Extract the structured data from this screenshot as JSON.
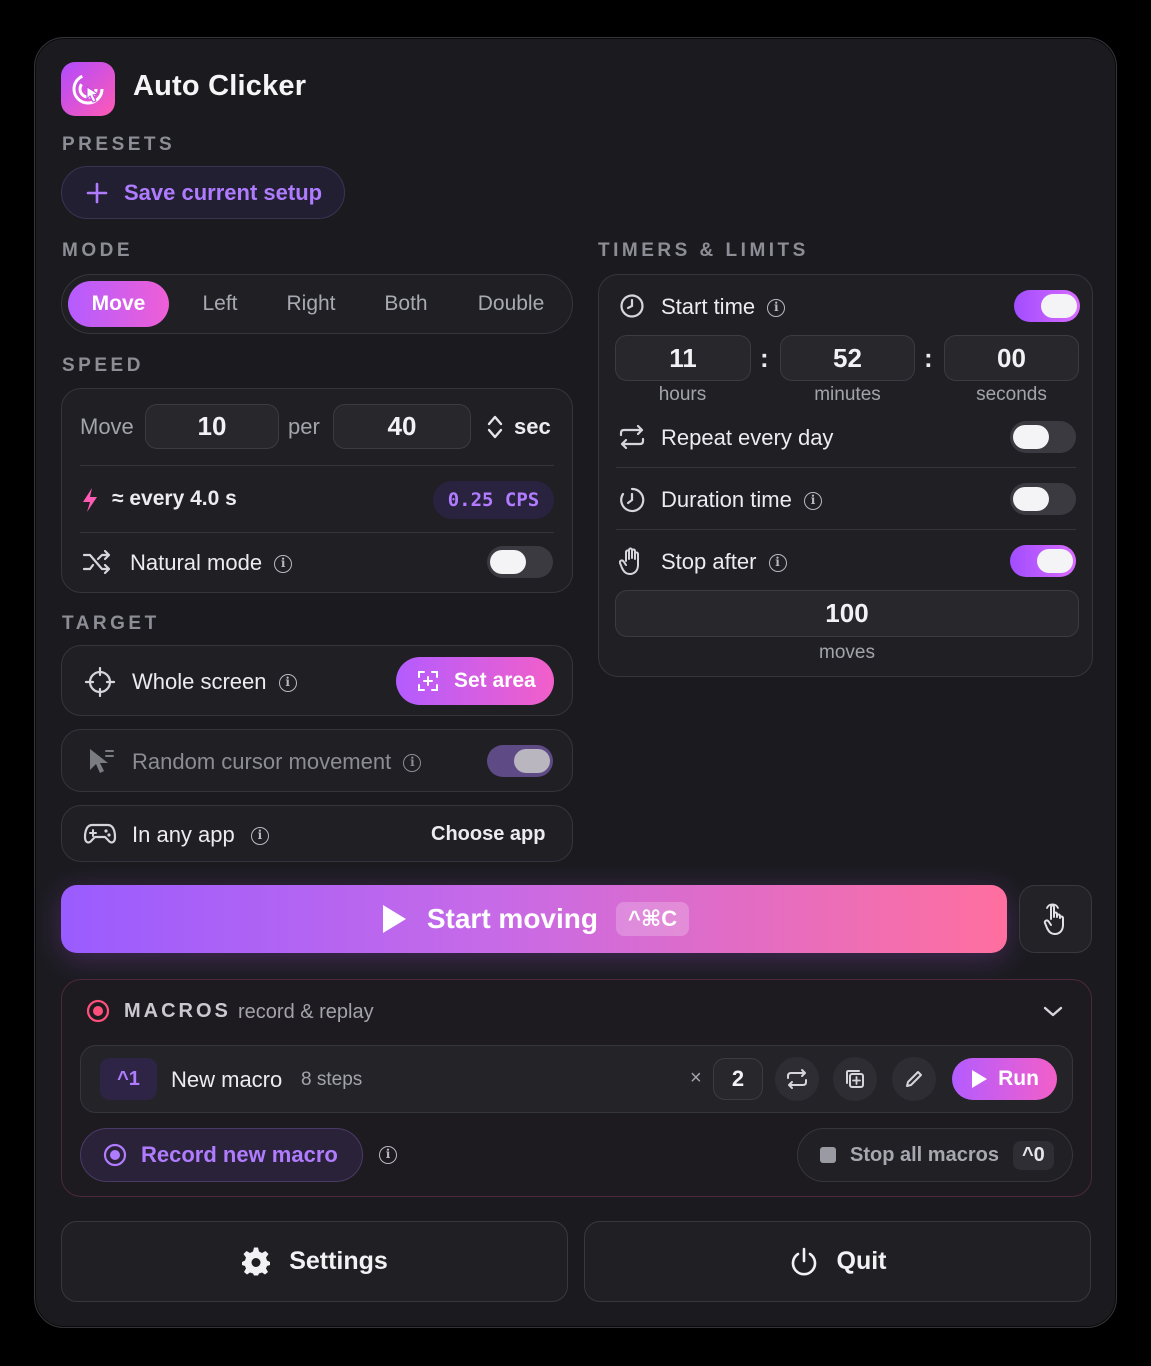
{
  "app": {
    "title": "Auto Clicker"
  },
  "presets": {
    "label": "PRESETS",
    "save_label": "Save current setup"
  },
  "mode": {
    "label": "MODE",
    "options": [
      "Move",
      "Left",
      "Right",
      "Both",
      "Double"
    ],
    "selected": "Move"
  },
  "speed": {
    "label": "SPEED",
    "action": "Move",
    "count": "10",
    "per": "per",
    "interval": "40",
    "unit": "sec",
    "summary": "≈ every 4.0 s",
    "cps": "0.25 CPS",
    "natural_mode_label": "Natural mode",
    "natural_mode_on": false
  },
  "target": {
    "label": "TARGET",
    "area_label": "Whole screen",
    "set_area_label": "Set area",
    "random_cursor_label": "Random cursor movement",
    "random_cursor_on": true,
    "app_label": "In any app",
    "choose_app_label": "Choose app"
  },
  "timers": {
    "label": "TIMERS & LIMITS",
    "start_time_label": "Start time",
    "start_time_on": true,
    "hours": "11",
    "minutes": "52",
    "seconds": "00",
    "hours_label": "hours",
    "minutes_label": "minutes",
    "seconds_label": "seconds",
    "sep": ":",
    "repeat_label": "Repeat every day",
    "repeat_on": false,
    "duration_label": "Duration time",
    "duration_on": false,
    "stop_after_label": "Stop after",
    "stop_after_on": true,
    "stop_after_value": "100",
    "stop_after_unit": "moves"
  },
  "start": {
    "label": "Start moving",
    "shortcut": "^⌘C"
  },
  "macros": {
    "label": "MACROS",
    "sub": "record & replay",
    "items": [
      {
        "hotkey": "^1",
        "name": "New macro",
        "steps": "8 steps",
        "times_prefix": "×",
        "times": "2",
        "run_label": "Run"
      }
    ],
    "record_label": "Record new macro",
    "stop_all_label": "Stop all macros",
    "stop_all_shortcut": "^0"
  },
  "footer": {
    "settings_label": "Settings",
    "quit_label": "Quit"
  },
  "colors": {
    "accent": "#a14dff",
    "accent_pink": "#ff5ab4",
    "background": "#1b1b1f"
  }
}
